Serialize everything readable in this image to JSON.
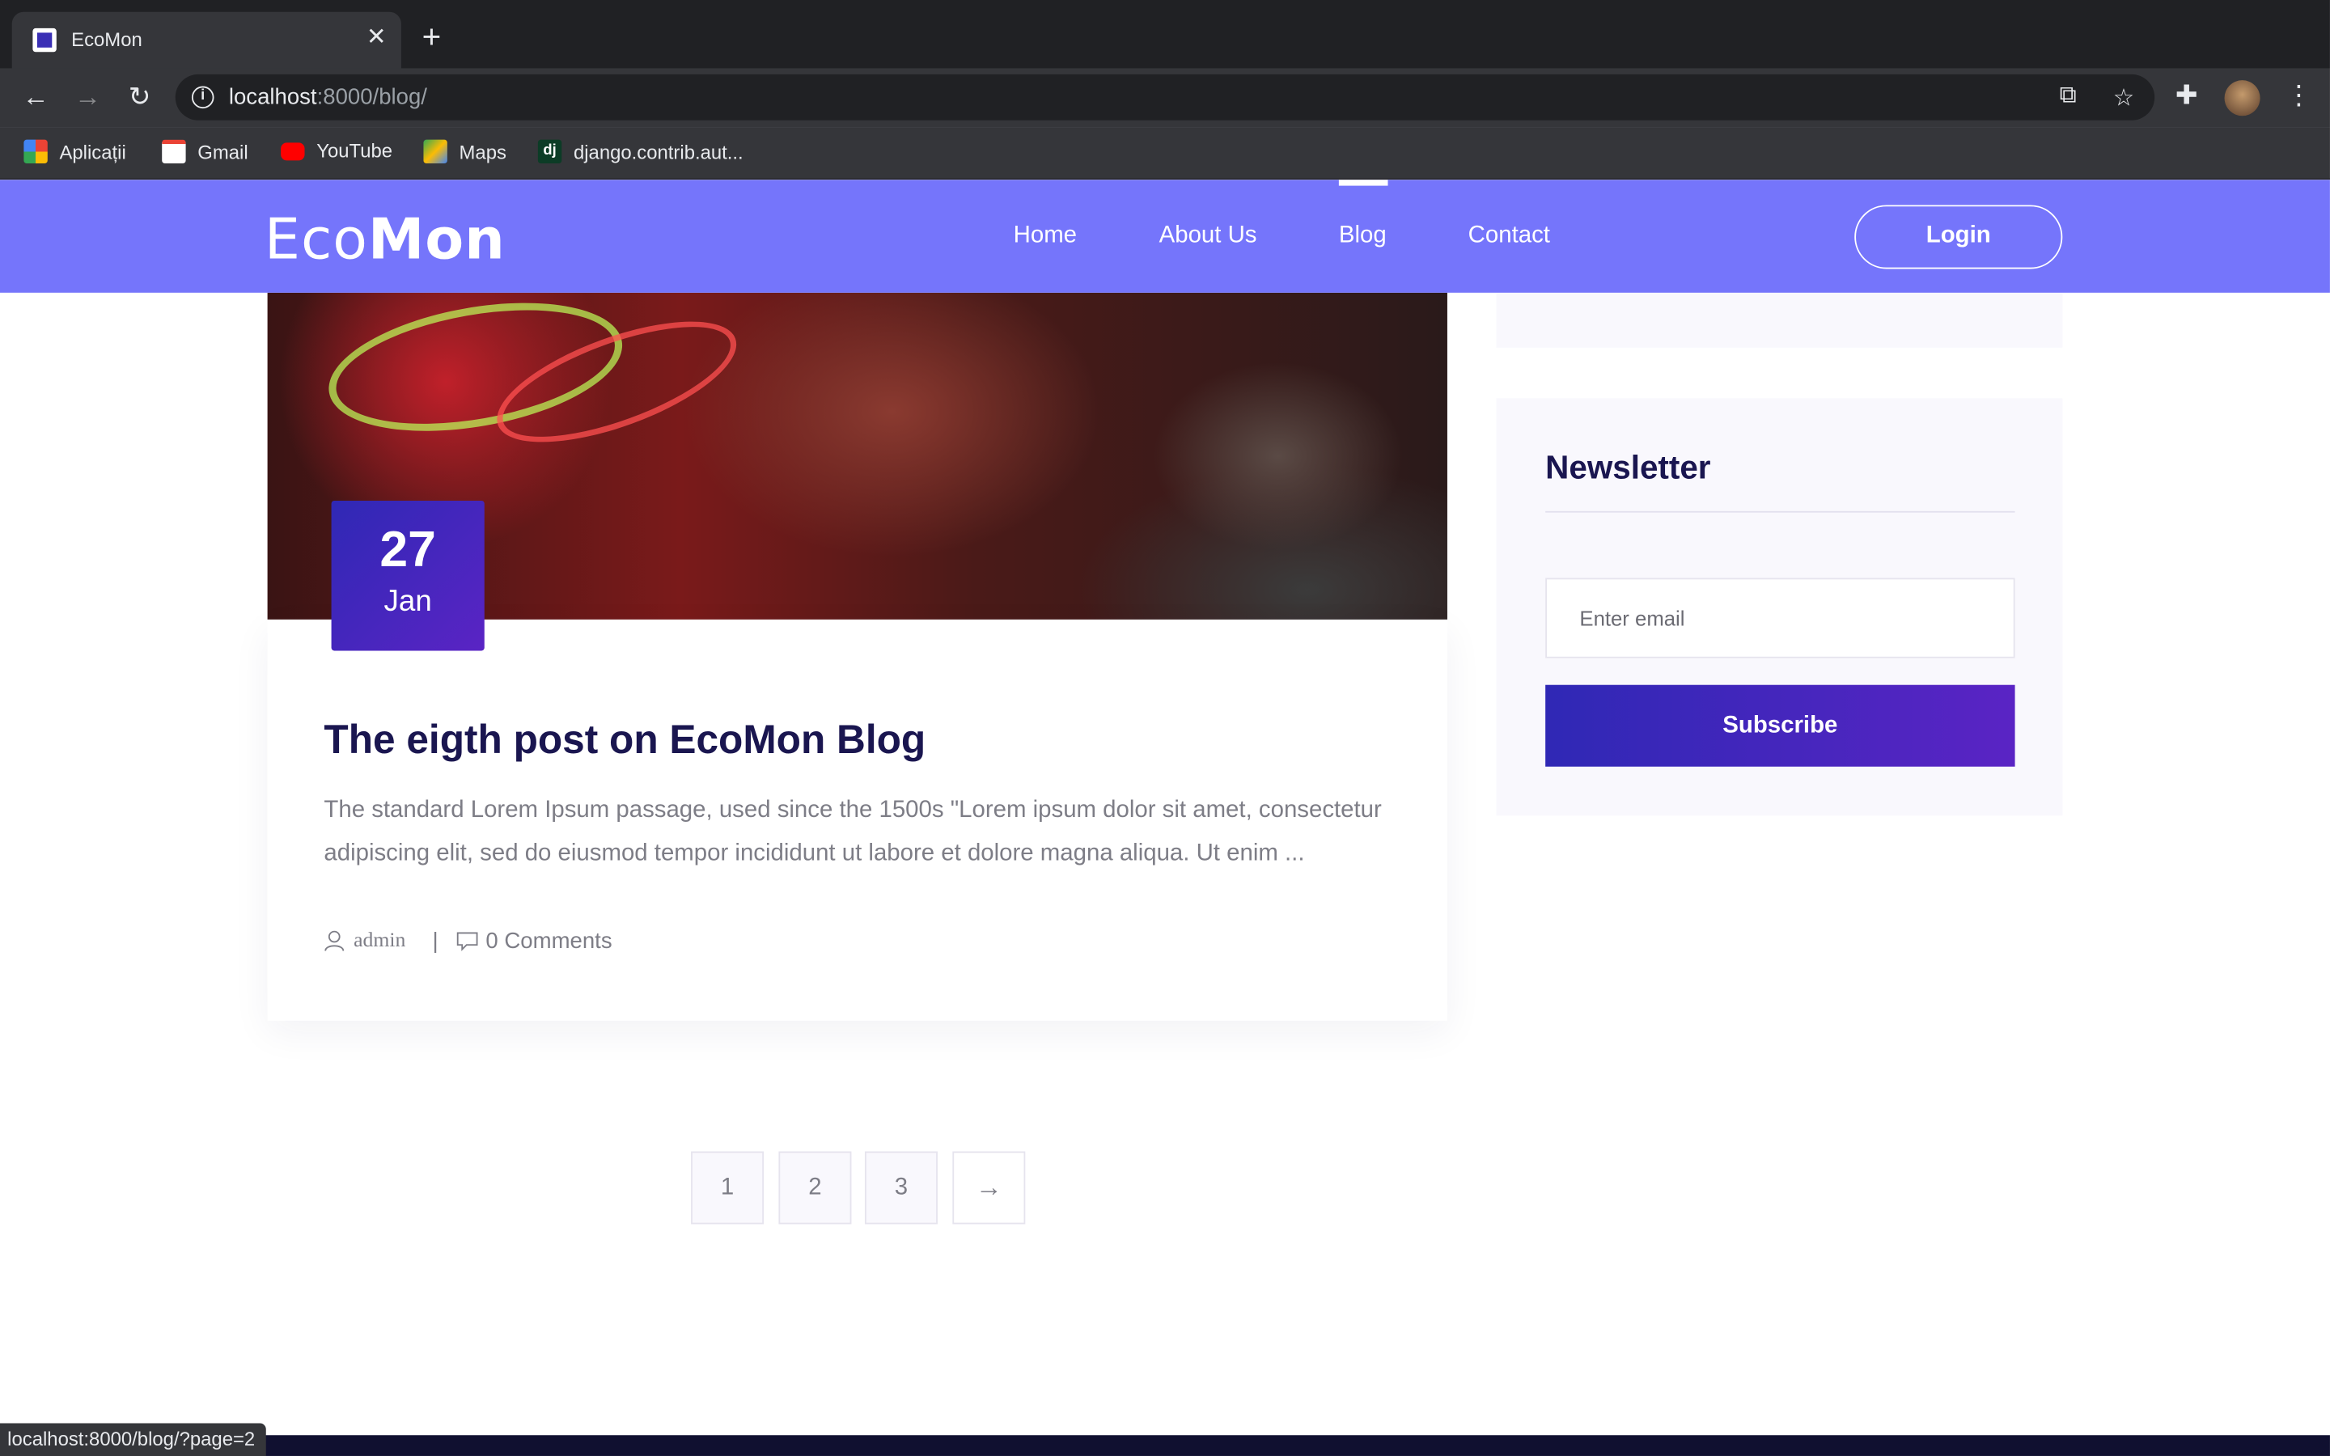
{
  "browser": {
    "tab_title": "EcoMon",
    "url_host": "localhost",
    "url_rest": ":8000/blog/",
    "bookmarks": [
      "Aplicații",
      "Gmail",
      "YouTube",
      "Maps",
      "django.contrib.aut..."
    ],
    "status_url": "localhost:8000/blog/?page=2"
  },
  "site": {
    "logo_light": "Eco",
    "logo_bold": "Mon",
    "nav": [
      "Home",
      "About Us",
      "Blog",
      "Contact"
    ],
    "active_nav": "Blog",
    "login_label": "Login"
  },
  "post": {
    "date_day": "27",
    "date_month": "Jan",
    "title": "The eigth post on EcoMon Blog",
    "excerpt": "The standard Lorem Ipsum passage, used since the 1500s \"Lorem ipsum dolor sit amet, consectetur adipiscing elit, sed do eiusmod tempor incididunt ut labore et dolore magna aliqua. Ut enim ...",
    "author": "admin",
    "comments": "0 Comments"
  },
  "newsletter": {
    "title": "Newsletter",
    "placeholder": "Enter email",
    "button_label": "Subscribe"
  },
  "pagination": {
    "pages": [
      "1",
      "2",
      "3"
    ],
    "next_icon": "arrow-right-icon"
  },
  "colors": {
    "header": "#7575fb",
    "accent_from": "#2f28b5",
    "accent_to": "#5a24c4",
    "title": "#1a1650"
  }
}
